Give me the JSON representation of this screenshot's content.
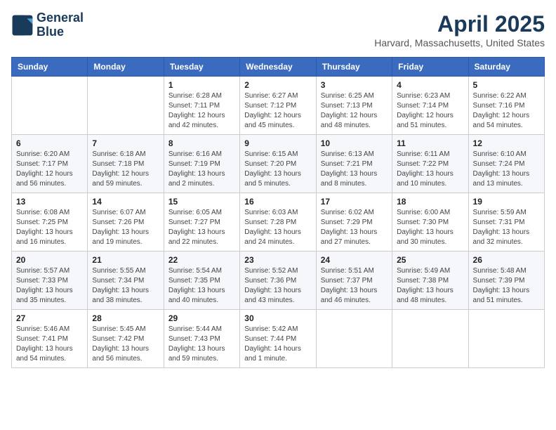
{
  "header": {
    "logo_line1": "General",
    "logo_line2": "Blue",
    "month": "April 2025",
    "location": "Harvard, Massachusetts, United States"
  },
  "weekdays": [
    "Sunday",
    "Monday",
    "Tuesday",
    "Wednesday",
    "Thursday",
    "Friday",
    "Saturday"
  ],
  "weeks": [
    [
      {
        "day": "",
        "info": ""
      },
      {
        "day": "",
        "info": ""
      },
      {
        "day": "1",
        "info": "Sunrise: 6:28 AM\nSunset: 7:11 PM\nDaylight: 12 hours\nand 42 minutes."
      },
      {
        "day": "2",
        "info": "Sunrise: 6:27 AM\nSunset: 7:12 PM\nDaylight: 12 hours\nand 45 minutes."
      },
      {
        "day": "3",
        "info": "Sunrise: 6:25 AM\nSunset: 7:13 PM\nDaylight: 12 hours\nand 48 minutes."
      },
      {
        "day": "4",
        "info": "Sunrise: 6:23 AM\nSunset: 7:14 PM\nDaylight: 12 hours\nand 51 minutes."
      },
      {
        "day": "5",
        "info": "Sunrise: 6:22 AM\nSunset: 7:16 PM\nDaylight: 12 hours\nand 54 minutes."
      }
    ],
    [
      {
        "day": "6",
        "info": "Sunrise: 6:20 AM\nSunset: 7:17 PM\nDaylight: 12 hours\nand 56 minutes."
      },
      {
        "day": "7",
        "info": "Sunrise: 6:18 AM\nSunset: 7:18 PM\nDaylight: 12 hours\nand 59 minutes."
      },
      {
        "day": "8",
        "info": "Sunrise: 6:16 AM\nSunset: 7:19 PM\nDaylight: 13 hours\nand 2 minutes."
      },
      {
        "day": "9",
        "info": "Sunrise: 6:15 AM\nSunset: 7:20 PM\nDaylight: 13 hours\nand 5 minutes."
      },
      {
        "day": "10",
        "info": "Sunrise: 6:13 AM\nSunset: 7:21 PM\nDaylight: 13 hours\nand 8 minutes."
      },
      {
        "day": "11",
        "info": "Sunrise: 6:11 AM\nSunset: 7:22 PM\nDaylight: 13 hours\nand 10 minutes."
      },
      {
        "day": "12",
        "info": "Sunrise: 6:10 AM\nSunset: 7:24 PM\nDaylight: 13 hours\nand 13 minutes."
      }
    ],
    [
      {
        "day": "13",
        "info": "Sunrise: 6:08 AM\nSunset: 7:25 PM\nDaylight: 13 hours\nand 16 minutes."
      },
      {
        "day": "14",
        "info": "Sunrise: 6:07 AM\nSunset: 7:26 PM\nDaylight: 13 hours\nand 19 minutes."
      },
      {
        "day": "15",
        "info": "Sunrise: 6:05 AM\nSunset: 7:27 PM\nDaylight: 13 hours\nand 22 minutes."
      },
      {
        "day": "16",
        "info": "Sunrise: 6:03 AM\nSunset: 7:28 PM\nDaylight: 13 hours\nand 24 minutes."
      },
      {
        "day": "17",
        "info": "Sunrise: 6:02 AM\nSunset: 7:29 PM\nDaylight: 13 hours\nand 27 minutes."
      },
      {
        "day": "18",
        "info": "Sunrise: 6:00 AM\nSunset: 7:30 PM\nDaylight: 13 hours\nand 30 minutes."
      },
      {
        "day": "19",
        "info": "Sunrise: 5:59 AM\nSunset: 7:31 PM\nDaylight: 13 hours\nand 32 minutes."
      }
    ],
    [
      {
        "day": "20",
        "info": "Sunrise: 5:57 AM\nSunset: 7:33 PM\nDaylight: 13 hours\nand 35 minutes."
      },
      {
        "day": "21",
        "info": "Sunrise: 5:55 AM\nSunset: 7:34 PM\nDaylight: 13 hours\nand 38 minutes."
      },
      {
        "day": "22",
        "info": "Sunrise: 5:54 AM\nSunset: 7:35 PM\nDaylight: 13 hours\nand 40 minutes."
      },
      {
        "day": "23",
        "info": "Sunrise: 5:52 AM\nSunset: 7:36 PM\nDaylight: 13 hours\nand 43 minutes."
      },
      {
        "day": "24",
        "info": "Sunrise: 5:51 AM\nSunset: 7:37 PM\nDaylight: 13 hours\nand 46 minutes."
      },
      {
        "day": "25",
        "info": "Sunrise: 5:49 AM\nSunset: 7:38 PM\nDaylight: 13 hours\nand 48 minutes."
      },
      {
        "day": "26",
        "info": "Sunrise: 5:48 AM\nSunset: 7:39 PM\nDaylight: 13 hours\nand 51 minutes."
      }
    ],
    [
      {
        "day": "27",
        "info": "Sunrise: 5:46 AM\nSunset: 7:41 PM\nDaylight: 13 hours\nand 54 minutes."
      },
      {
        "day": "28",
        "info": "Sunrise: 5:45 AM\nSunset: 7:42 PM\nDaylight: 13 hours\nand 56 minutes."
      },
      {
        "day": "29",
        "info": "Sunrise: 5:44 AM\nSunset: 7:43 PM\nDaylight: 13 hours\nand 59 minutes."
      },
      {
        "day": "30",
        "info": "Sunrise: 5:42 AM\nSunset: 7:44 PM\nDaylight: 14 hours\nand 1 minute."
      },
      {
        "day": "",
        "info": ""
      },
      {
        "day": "",
        "info": ""
      },
      {
        "day": "",
        "info": ""
      }
    ]
  ]
}
